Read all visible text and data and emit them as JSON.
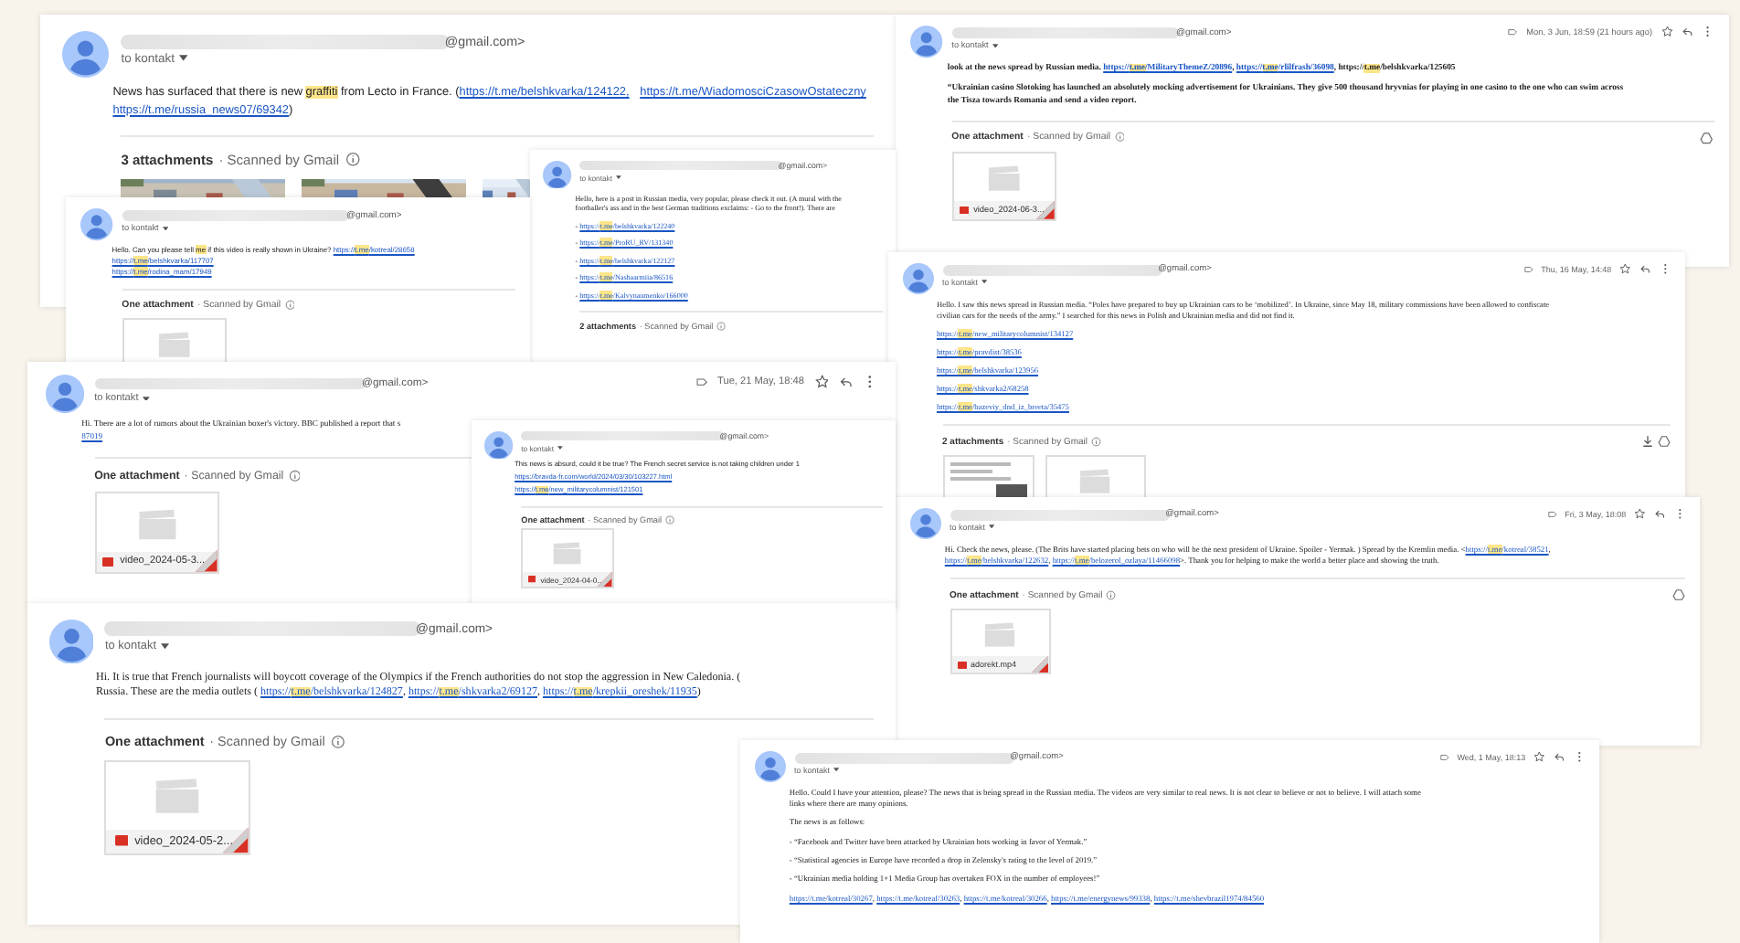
{
  "emails": [
    {
      "sender": "@gmail.com>",
      "recipient": "to kontakt",
      "body": [
        [
          [
            {
              "kind": "text",
              "text": "News has surfaced that there is new "
            },
            {
              "kind": "mark",
              "text": "graffiti"
            },
            {
              "kind": "text",
              "text": " from Lecto in France. ("
            },
            {
              "kind": "link",
              "text": "https://t.me/belshkvarka/124122,"
            },
            {
              "kind": "link",
              "text": "https://t.me/WiadomosciCzasowOstateczny"
            }
          ],
          [
            {
              "kind": "link",
              "text": "https://t.me/russia_news07/69342"
            },
            {
              "kind": "text",
              "text": ")"
            }
          ]
        ]
      ],
      "attachments": {
        "count": "3 attachments",
        "scanned": "· Scanned by Gmail"
      }
    },
    {
      "sender": "@gmail.com>",
      "recipient": "to kontakt",
      "body": [
        [
          [
            {
              "kind": "text",
              "text": "Hello. Can you please tell "
            },
            {
              "kind": "mark",
              "text": "me"
            },
            {
              "kind": "text",
              "text": " if this video is really shown in Ukraine? "
            },
            {
              "kind": "marked_link",
              "parts": [
                "https://",
                "t.me",
                "/kotreal/28658"
              ]
            }
          ],
          [
            {
              "kind": "marked_link",
              "parts": [
                "https://",
                "t.me",
                "/belshkvarka/117707"
              ]
            }
          ],
          [
            {
              "kind": "marked_link",
              "parts": [
                "https://",
                "t.me",
                "/rodina_mam/17949"
              ]
            }
          ]
        ]
      ],
      "attachments": {
        "count": "One attachment",
        "scanned": "· Scanned by Gmail",
        "items": [
          {
            "kind": "video"
          }
        ]
      }
    },
    {
      "sender": "@gmail.com>",
      "recipient": "to kontakt",
      "body": [
        [
          [
            {
              "kind": "text",
              "text": "Hello, here is a post in Russian media, very popular, please check it out. (A mural with the"
            }
          ],
          [
            {
              "kind": "text",
              "text": "footballer's ass and in the best German traditions exclaims: - Go to the front!). There are"
            }
          ]
        ],
        [
          [
            {
              "kind": "text",
              "text": "- "
            },
            {
              "kind": "marked_link",
              "parts": [
                "https://",
                "t.me",
                "/belshkvarka/122240"
              ]
            }
          ]
        ],
        [
          [
            {
              "kind": "text",
              "text": "- "
            },
            {
              "kind": "marked_link",
              "parts": [
                "https://",
                "t.me",
                "/ProRU_RV/131340"
              ]
            }
          ]
        ],
        [
          [
            {
              "kind": "text",
              "text": "- "
            },
            {
              "kind": "marked_link",
              "parts": [
                "https://",
                "t.me",
                "/belshkvarka/122127"
              ]
            }
          ]
        ],
        [
          [
            {
              "kind": "text",
              "text": "- "
            },
            {
              "kind": "marked_link",
              "parts": [
                "https://",
                "t.me",
                "/Nashaarmiia/86516"
              ]
            }
          ]
        ],
        [
          [
            {
              "kind": "text",
              "text": "- "
            },
            {
              "kind": "marked_link",
              "parts": [
                "https://",
                "t.me",
                "/Kalvynaumenko/166000"
              ]
            }
          ]
        ]
      ],
      "attachments": {
        "count": "2 attachments",
        "scanned": "· Scanned by Gmail"
      }
    },
    {
      "sender": "@gmail.com>",
      "recipient": "to kontakt",
      "date": "Mon, 3 Jun, 18:59 (21 hours ago)",
      "body": [
        [
          [
            {
              "kind": "text",
              "text": "look at the news spread by Russian media. "
            },
            {
              "kind": "marked_link",
              "parts": [
                "https://",
                "t.me",
                "/MilitaryThemeZ/20896"
              ]
            },
            {
              "kind": "text",
              "text": ", "
            },
            {
              "kind": "marked_link",
              "parts": [
                "https://",
                "t.me",
                "/rlilfrash/36098"
              ]
            },
            {
              "kind": "text",
              "text": ", https://"
            },
            {
              "kind": "mark",
              "text": "t.me"
            },
            {
              "kind": "text",
              "text": "/belshkvarka/125605"
            }
          ]
        ],
        [
          [
            {
              "kind": "text",
              "text": "“Ukrainian casino Slotoking has launched an absolutely mocking advertisement for Ukrainians. They give 500 thousand hryvnias for playing in one casino to the one who can swim across"
            }
          ],
          [
            {
              "kind": "text",
              "text": "the Tisza towards Romania and send a video report."
            }
          ]
        ]
      ],
      "attachments": {
        "count": "One attachment",
        "scanned": "· Scanned by Gmail",
        "items": [
          {
            "kind": "video",
            "name": "video_2024-06-3..."
          }
        ]
      }
    },
    {
      "sender": "@gmail.com>",
      "recipient": "to kontakt",
      "date": "Thu, 16 May, 14:48",
      "body": [
        [
          [
            {
              "kind": "text",
              "text": "Hello. I saw this news spread in Russian media. “Poles have prepared to buy up Ukrainian cars to be ‘mobilized’. In Ukraine, since May 18, military commissions have been allowed to confiscate"
            }
          ],
          [
            {
              "kind": "text",
              "text": "civilian cars for the needs of the army.” I searched for this news in Polish and Ukrainian media and did not find it."
            }
          ]
        ],
        [
          [
            {
              "kind": "marked_link",
              "parts": [
                "https://",
                "t.me",
                "/new_militarycolumnist/134127"
              ]
            }
          ]
        ],
        [
          [
            {
              "kind": "marked_link",
              "parts": [
                "https://",
                "t.me",
                "/pravdist/38536"
              ]
            }
          ]
        ],
        [
          [
            {
              "kind": "marked_link",
              "parts": [
                "https://",
                "t.me",
                "/belshkvarka/123956"
              ]
            }
          ]
        ],
        [
          [
            {
              "kind": "marked_link",
              "parts": [
                "https://",
                "t.me",
                "/shkvarka2/68258"
              ]
            }
          ]
        ],
        [
          [
            {
              "kind": "marked_link",
              "parts": [
                "https://",
                "t.me",
                "/bazeviy_dnd_iz_breeta/35475"
              ]
            }
          ]
        ]
      ],
      "attachments": {
        "count": "2 attachments",
        "scanned": "· Scanned by Gmail",
        "items": [
          {
            "kind": "document"
          },
          {
            "kind": "video"
          }
        ]
      }
    },
    {
      "sender": "@gmail.com>",
      "recipient": "to kontakt",
      "date": "Tue, 21 May, 18:48",
      "body": [
        [
          [
            {
              "kind": "text",
              "text": "Hi. There are a lot of rumors about the Ukrainian boxer's victory. BBC published a report that s"
            }
          ],
          [
            {
              "kind": "link",
              "text": "87019"
            }
          ]
        ]
      ],
      "attachments": {
        "count": "One attachment",
        "scanned": "· Scanned by Gmail",
        "items": [
          {
            "kind": "video",
            "name": "video_2024-05-3..."
          }
        ]
      }
    },
    {
      "sender": "@gmail.com>",
      "recipient": "to kontakt",
      "body": [
        [
          [
            {
              "kind": "text",
              "text": "This news is absurd, could it be true? The French secret service is not taking children under 1"
            }
          ]
        ],
        [
          [
            {
              "kind": "link",
              "text": "https://bravda-fr.com/world/2024/03/30/103227.html"
            }
          ]
        ],
        [
          [
            {
              "kind": "marked_link",
              "parts": [
                "https://",
                "t.me",
                "/new_militarycolumnist/121501"
              ]
            }
          ]
        ]
      ],
      "attachments": {
        "count": "One attachment",
        "scanned": "· Scanned by Gmail",
        "items": [
          {
            "kind": "video",
            "name": "video_2024-04-0..."
          }
        ]
      }
    },
    {
      "sender": "@gmail.com>",
      "recipient": "to kontakt",
      "date": "Fri, 3 May, 18:08",
      "body": [
        [
          [
            {
              "kind": "text",
              "text": "Hi. Check the news, please. (The Brits have started placing bets on who will be the next president of Ukraine. Spoiler - Yermak. ) Spread by the Kremlin media. <"
            },
            {
              "kind": "marked_link",
              "parts": [
                "https://",
                "t.me",
                "/kotreal/38521"
              ]
            },
            {
              "kind": "text",
              "text": ","
            }
          ],
          [
            {
              "kind": "marked_link",
              "parts": [
                "https://",
                "t.me",
                "/belshkvarka/122632"
              ]
            },
            {
              "kind": "text",
              "text": ", "
            },
            {
              "kind": "marked_link",
              "parts": [
                "https://",
                "t.me",
                "/belozerol_ozlaya/11466098"
              ]
            },
            {
              "kind": "text",
              "text": ">. Thank you for helping to make the world a better place and showing the truth."
            }
          ]
        ]
      ],
      "attachments": {
        "count": "One attachment",
        "scanned": "· Scanned by Gmail",
        "items": [
          {
            "kind": "video",
            "name": "adorekt.mp4"
          }
        ]
      }
    },
    {
      "sender": "@gmail.com>",
      "recipient": "to kontakt",
      "body": [
        [
          [
            {
              "kind": "text",
              "text": "Hi. It is true that French journalists will boycott coverage of the Olympics if the French authorities do not stop the aggression in New Caledonia. ("
            }
          ],
          [
            {
              "kind": "text",
              "text": "Russia. These are the media outlets ( "
            },
            {
              "kind": "marked_link",
              "parts": [
                "https://",
                "t.me",
                "/belshkvarka/124827"
              ]
            },
            {
              "kind": "text",
              "text": ", "
            },
            {
              "kind": "marked_link",
              "parts": [
                "https://",
                "t.me",
                "/shkvarka2/69127"
              ]
            },
            {
              "kind": "text",
              "text": ", "
            },
            {
              "kind": "marked_link",
              "parts": [
                "https://",
                "t.me",
                "/krepkii_oreshek/11935"
              ]
            },
            {
              "kind": "text",
              "text": ")"
            }
          ]
        ]
      ],
      "attachments": {
        "count": "One attachment",
        "scanned": "· Scanned by Gmail",
        "items": [
          {
            "kind": "video",
            "name": "video_2024-05-2..."
          }
        ]
      }
    },
    {
      "sender": "@gmail.com>",
      "recipient": "to kontakt",
      "date": "Wed, 1 May, 18:13",
      "body": [
        [
          [
            {
              "kind": "text",
              "text": "Hello. Could I have your attention, please? The news that is being spread in the Russian media. The videos are very similar to real news. It is not clear to believe or not to believe. I will attach some"
            }
          ],
          [
            {
              "kind": "text",
              "text": "links where there are many opinions."
            }
          ]
        ],
        [
          [
            {
              "kind": "text",
              "text": "The news is as follows:"
            }
          ]
        ],
        [
          [
            {
              "kind": "text",
              "text": "- “Facebook and Twitter have been attacked by Ukrainian bots working in favor of Yermak.”"
            }
          ]
        ],
        [
          [
            {
              "kind": "text",
              "text": "- “Statistical agencies in Europe have recorded a drop in Zelensky's rating to the level of 2019.”"
            }
          ]
        ],
        [
          [
            {
              "kind": "text",
              "text": "- “Ukrainian media holding 1+1 Media Group has overtaken FOX in the number of employees!”"
            }
          ]
        ],
        [
          [
            {
              "kind": "link",
              "text": "https://t.me/kotreal/30267"
            },
            {
              "kind": "text",
              "text": ", "
            },
            {
              "kind": "link",
              "text": "https://t.me/kotreal/30263"
            },
            {
              "kind": "text",
              "text": ", "
            },
            {
              "kind": "link",
              "text": "https://t.me/kotreal/30266"
            },
            {
              "kind": "text",
              "text": ", "
            },
            {
              "kind": "link",
              "text": "https://t.me/energynews/99338"
            },
            {
              "kind": "text",
              "text": ", "
            },
            {
              "kind": "link",
              "text": "https://t.me/shevbrazil1974/84560"
            }
          ]
        ]
      ]
    }
  ]
}
